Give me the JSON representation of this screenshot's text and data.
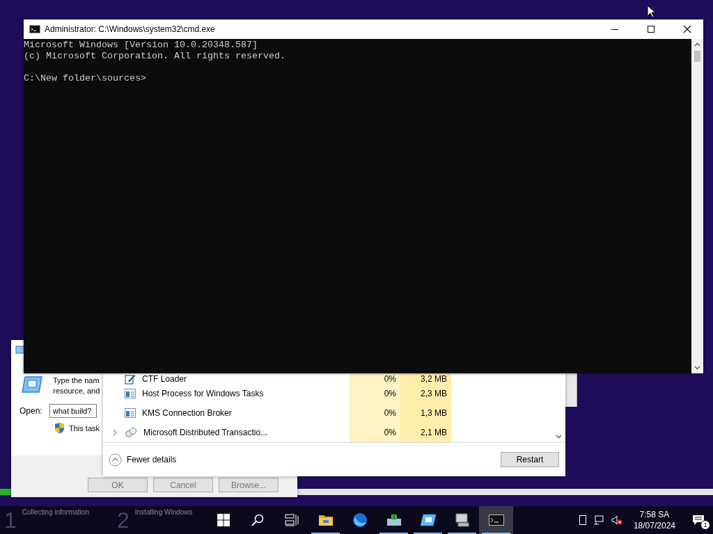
{
  "setup": {
    "progress": {
      "level": 0.016
    },
    "steps": [
      {
        "number": "1",
        "label": "Collecting information"
      },
      {
        "number": "2",
        "label": "Installing Windows"
      }
    ]
  },
  "run_dialog": {
    "description_lines": [
      "Type the nam",
      "resource, and"
    ],
    "open_label": "Open:",
    "open_value": "what build?",
    "admin_note": "This task",
    "buttons": [
      "OK",
      "Cancel",
      "Browse..."
    ]
  },
  "task_manager": {
    "processes": [
      {
        "name": "CTF Loader",
        "kind": "pen",
        "expandable": false,
        "cpu": "0%",
        "memory": "3,2 MB"
      },
      {
        "name": "Host Process for Windows Tasks",
        "kind": "window",
        "expandable": false,
        "cpu": "0%",
        "memory": "2,3 MB"
      },
      {
        "name": "KMS Connection Broker",
        "kind": "window",
        "expandable": false,
        "cpu": "0%",
        "memory": "1,3 MB"
      },
      {
        "name": "Microsoft Distributed Transactio...",
        "kind": "service",
        "expandable": true,
        "cpu": "0%",
        "memory": "2,1 MB"
      }
    ],
    "fewer_details": "Fewer details",
    "restart_button": "Restart"
  },
  "cmd_window": {
    "title": "Administrator: C:\\Windows\\system32\\cmd.exe",
    "paragraphs": [
      [
        "Microsoft Windows [Version 10.0.20348.587]",
        "(c) Microsoft Corporation. All rights reserved."
      ],
      [
        "C:\\New folder\\sources>"
      ]
    ]
  },
  "taskbar": {
    "apps": [
      {
        "kind": "explorer",
        "running": true,
        "selected": false
      },
      {
        "kind": "firefox",
        "running": false,
        "selected": false
      },
      {
        "kind": "green",
        "running": true,
        "selected": false
      },
      {
        "kind": "blue",
        "running": true,
        "selected": false
      },
      {
        "kind": "gray",
        "running": true,
        "selected": false
      },
      {
        "kind": "cmd",
        "running": true,
        "selected": true
      }
    ],
    "time": "7:58 SA",
    "date": "18/07/2024",
    "notification_count": "1"
  }
}
